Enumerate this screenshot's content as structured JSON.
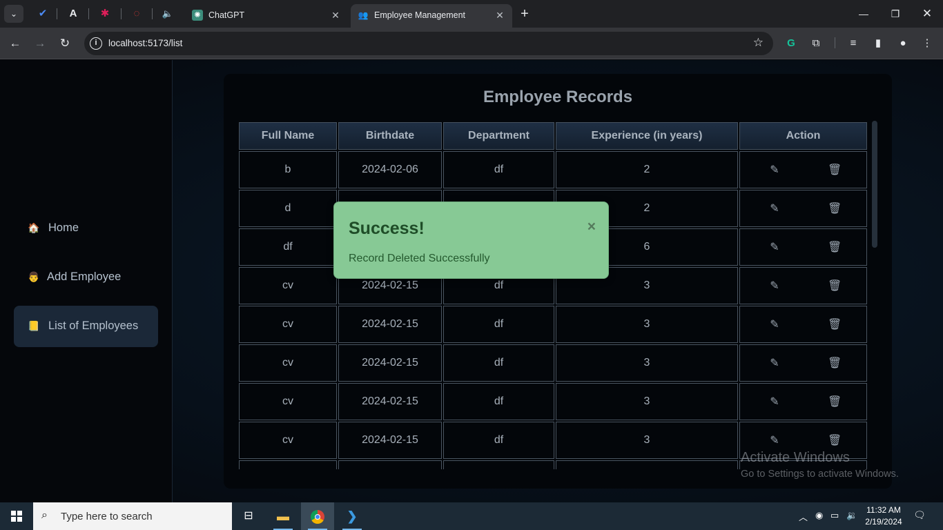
{
  "browser": {
    "tabs": [
      {
        "title": "ChatGPT",
        "icon": "chatgpt-icon"
      },
      {
        "title": "Employee Management",
        "icon": "people-icon",
        "active": true
      }
    ],
    "url": "localhost:5173/list"
  },
  "sidebar": {
    "items": [
      {
        "label": "Home",
        "icon": "home-icon"
      },
      {
        "label": "Add Employee",
        "icon": "person-icon"
      },
      {
        "label": "List of Employees",
        "icon": "list-icon",
        "active": true
      }
    ]
  },
  "main": {
    "title": "Employee Records",
    "table": {
      "headers": [
        "Full Name",
        "Birthdate",
        "Department",
        "Experience (in years)",
        "Action"
      ],
      "rows": [
        [
          "b",
          "2024-02-06",
          "df",
          "2"
        ],
        [
          "d",
          "",
          "",
          "2"
        ],
        [
          "df",
          "",
          "",
          "6"
        ],
        [
          "cv",
          "2024-02-15",
          "df",
          "3"
        ],
        [
          "cv",
          "2024-02-15",
          "df",
          "3"
        ],
        [
          "cv",
          "2024-02-15",
          "df",
          "3"
        ],
        [
          "cv",
          "2024-02-15",
          "df",
          "3"
        ],
        [
          "cv",
          "2024-02-15",
          "df",
          "3"
        ]
      ]
    }
  },
  "toast": {
    "title": "Success!",
    "close": "×",
    "message": "Record Deleted Successfully",
    "color": "#87c995"
  },
  "watermark": {
    "line1": "Activate Windows",
    "line2": "Go to Settings to activate Windows."
  },
  "taskbar": {
    "search_placeholder": "Type here to search",
    "time": "11:32 AM",
    "date": "2/19/2024"
  }
}
